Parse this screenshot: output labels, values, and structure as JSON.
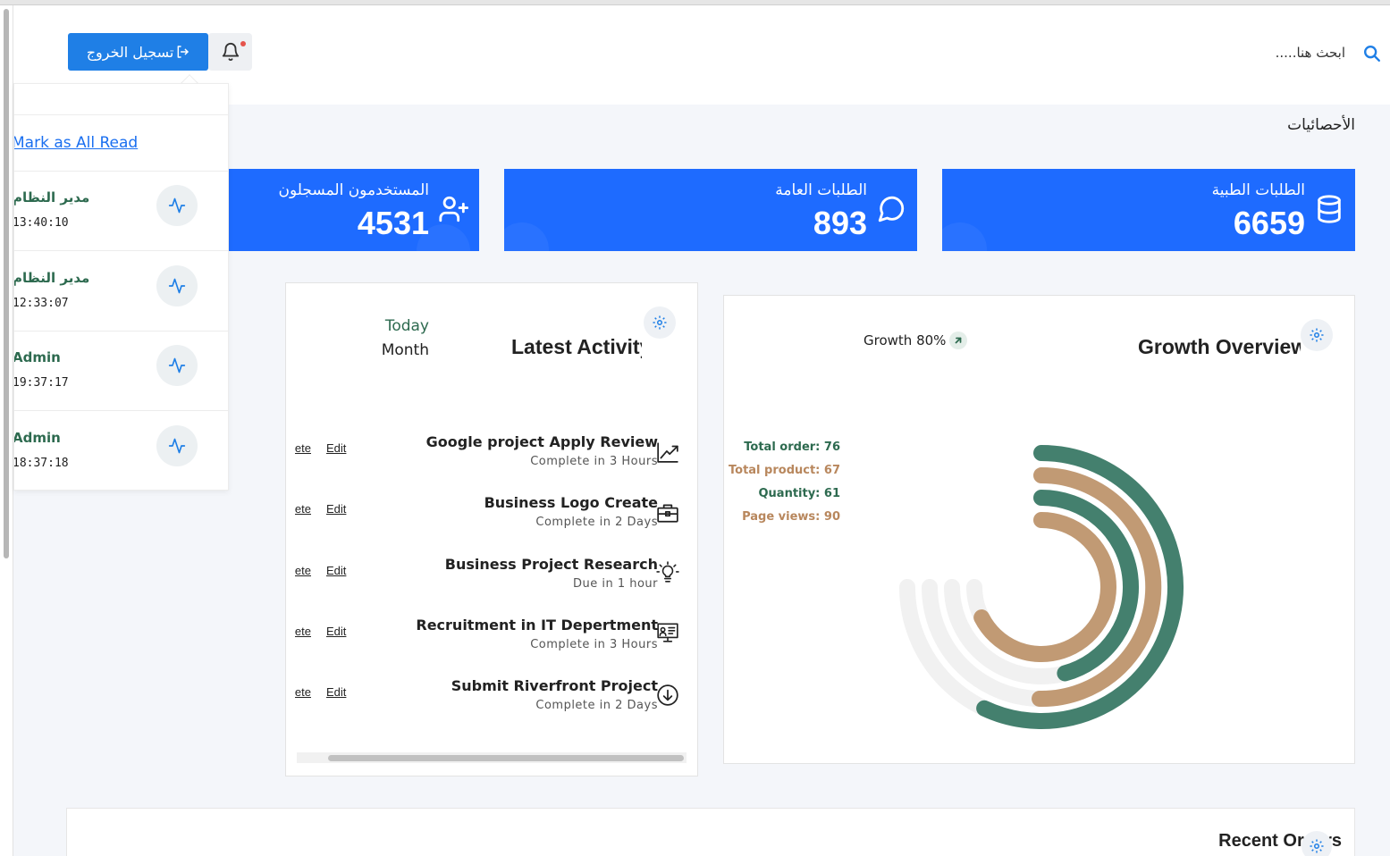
{
  "header": {
    "search_placeholder": "ابحث هنا.....",
    "logout_label": "تسجيل الخروج",
    "icons": {
      "search": "search-icon",
      "bell": "bell-icon",
      "logout": "logout-icon"
    },
    "accent_color": "#1f7fe6"
  },
  "page": {
    "title": "الأحصائيات"
  },
  "stats": [
    {
      "label": "الطلبات الطبية",
      "value": "6659",
      "icon": "database-icon"
    },
    {
      "label": "الطلبات العامة",
      "value": "893",
      "icon": "message-circle-icon"
    },
    {
      "label": "المستخدمون المسجلون",
      "value": "4531",
      "icon": "user-plus-icon"
    }
  ],
  "latest_activity": {
    "title": "Latest Activity",
    "filters": [
      "Today",
      "Month"
    ],
    "delete_label": "Delete",
    "edit_label": "Edit",
    "items": [
      {
        "title": "Google project Apply Review",
        "subtitle": "Complete in 3 Hours",
        "icon": "trending-up-icon"
      },
      {
        "title": "Business Logo Create",
        "subtitle": "Complete in 2 Days",
        "icon": "briefcase-icon"
      },
      {
        "title": "Business Project Research",
        "subtitle": "Due in 1 hour",
        "icon": "lightbulb-icon"
      },
      {
        "title": "Recruitment in IT Depertment",
        "subtitle": "Complete in 3 Hours",
        "icon": "presentation-icon"
      },
      {
        "title": "Submit Riverfront Project",
        "subtitle": "Complete in 2 Days",
        "icon": "arrow-down-circle-icon"
      }
    ]
  },
  "growth": {
    "title": "Growth Overview",
    "badge": "Growth 80%",
    "colors": {
      "green": "#44806e",
      "tan": "#c19a74",
      "track": "#f1f1f1"
    },
    "legend": [
      {
        "label": "Total order: 76",
        "color": "#2d6a4f"
      },
      {
        "label": "Total product: 67",
        "color": "#b8875d"
      },
      {
        "label": "Quantity: 61",
        "color": "#2d6a4f"
      },
      {
        "label": "Page views: 90",
        "color": "#b8875d"
      }
    ]
  },
  "chart_data": {
    "type": "radialBar",
    "categories": [
      "Total order",
      "Total product",
      "Quantity",
      "Page views"
    ],
    "values": [
      76,
      67,
      61,
      90
    ],
    "ylim": [
      0,
      100
    ]
  },
  "notifications": {
    "mark_all_label": "Mark as All Read",
    "items": [
      {
        "name": "مدير النظام",
        "time": "13:40:10"
      },
      {
        "name": "مدير النظام",
        "time": "12:33:07"
      },
      {
        "name": "Admin",
        "time": "19:37:17"
      },
      {
        "name": "Admin",
        "time": "18:37:18"
      }
    ]
  },
  "recent_orders": {
    "title": "Recent Orders"
  }
}
